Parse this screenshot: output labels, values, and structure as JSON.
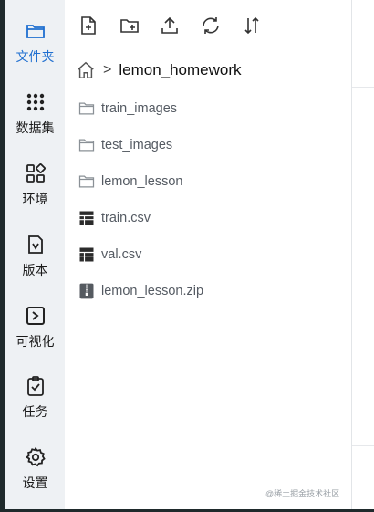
{
  "sidebar": {
    "items": [
      {
        "label": "文件夹",
        "icon": "folder-icon",
        "active": true
      },
      {
        "label": "数据集",
        "icon": "dataset-icon"
      },
      {
        "label": "环境",
        "icon": "environment-icon"
      },
      {
        "label": "版本",
        "icon": "version-icon"
      },
      {
        "label": "可视化",
        "icon": "visualization-icon"
      },
      {
        "label": "任务",
        "icon": "task-icon"
      },
      {
        "label": "设置",
        "icon": "gear-icon"
      }
    ]
  },
  "toolbar": {
    "buttons": [
      "new-file-icon",
      "new-folder-icon",
      "upload-icon",
      "refresh-icon",
      "sort-icon"
    ]
  },
  "breadcrumb": {
    "separator": ">",
    "current": "lemon_homework"
  },
  "files": [
    {
      "name": "train_images",
      "type": "folder"
    },
    {
      "name": "test_images",
      "type": "folder"
    },
    {
      "name": "lemon_lesson",
      "type": "folder"
    },
    {
      "name": "train.csv",
      "type": "csv"
    },
    {
      "name": "val.csv",
      "type": "csv"
    },
    {
      "name": "lemon_lesson.zip",
      "type": "zip"
    }
  ],
  "watermark": "@稀土掘金技术社区",
  "colors": {
    "accent": "#1f6fd0",
    "sidebar_bg": "#eef1f4",
    "folder_stroke": "#8a9096"
  }
}
